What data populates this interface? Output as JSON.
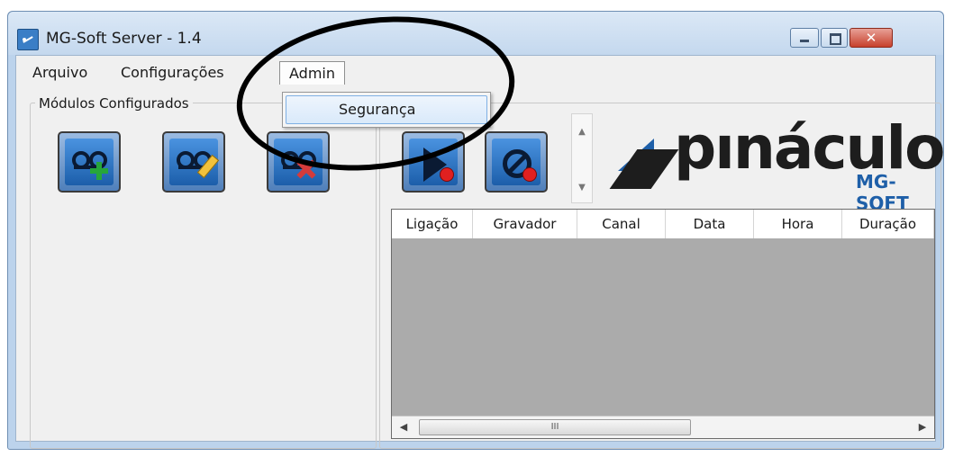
{
  "window": {
    "title": "MG-Soft Server - 1.4"
  },
  "menubar": {
    "items": [
      "Arquivo",
      "Configurações",
      "Admin"
    ]
  },
  "admin_menu": {
    "items": [
      "Segurança"
    ]
  },
  "modulos": {
    "label": "Módulos Configurados"
  },
  "toolbar": {
    "icons": [
      "voicemail-add-icon",
      "voicemail-edit-icon",
      "voicemail-delete-icon",
      "play-record-icon",
      "stop-record-icon"
    ]
  },
  "logo": {
    "main": "pınáculo",
    "sub": "MG-SOFT",
    "brand_color": "#1e5fa8"
  },
  "grid": {
    "columns": [
      "Ligação",
      "Gravador",
      "Canal",
      "Data",
      "Hora",
      "Duração"
    ],
    "scroll_grip": "III"
  }
}
